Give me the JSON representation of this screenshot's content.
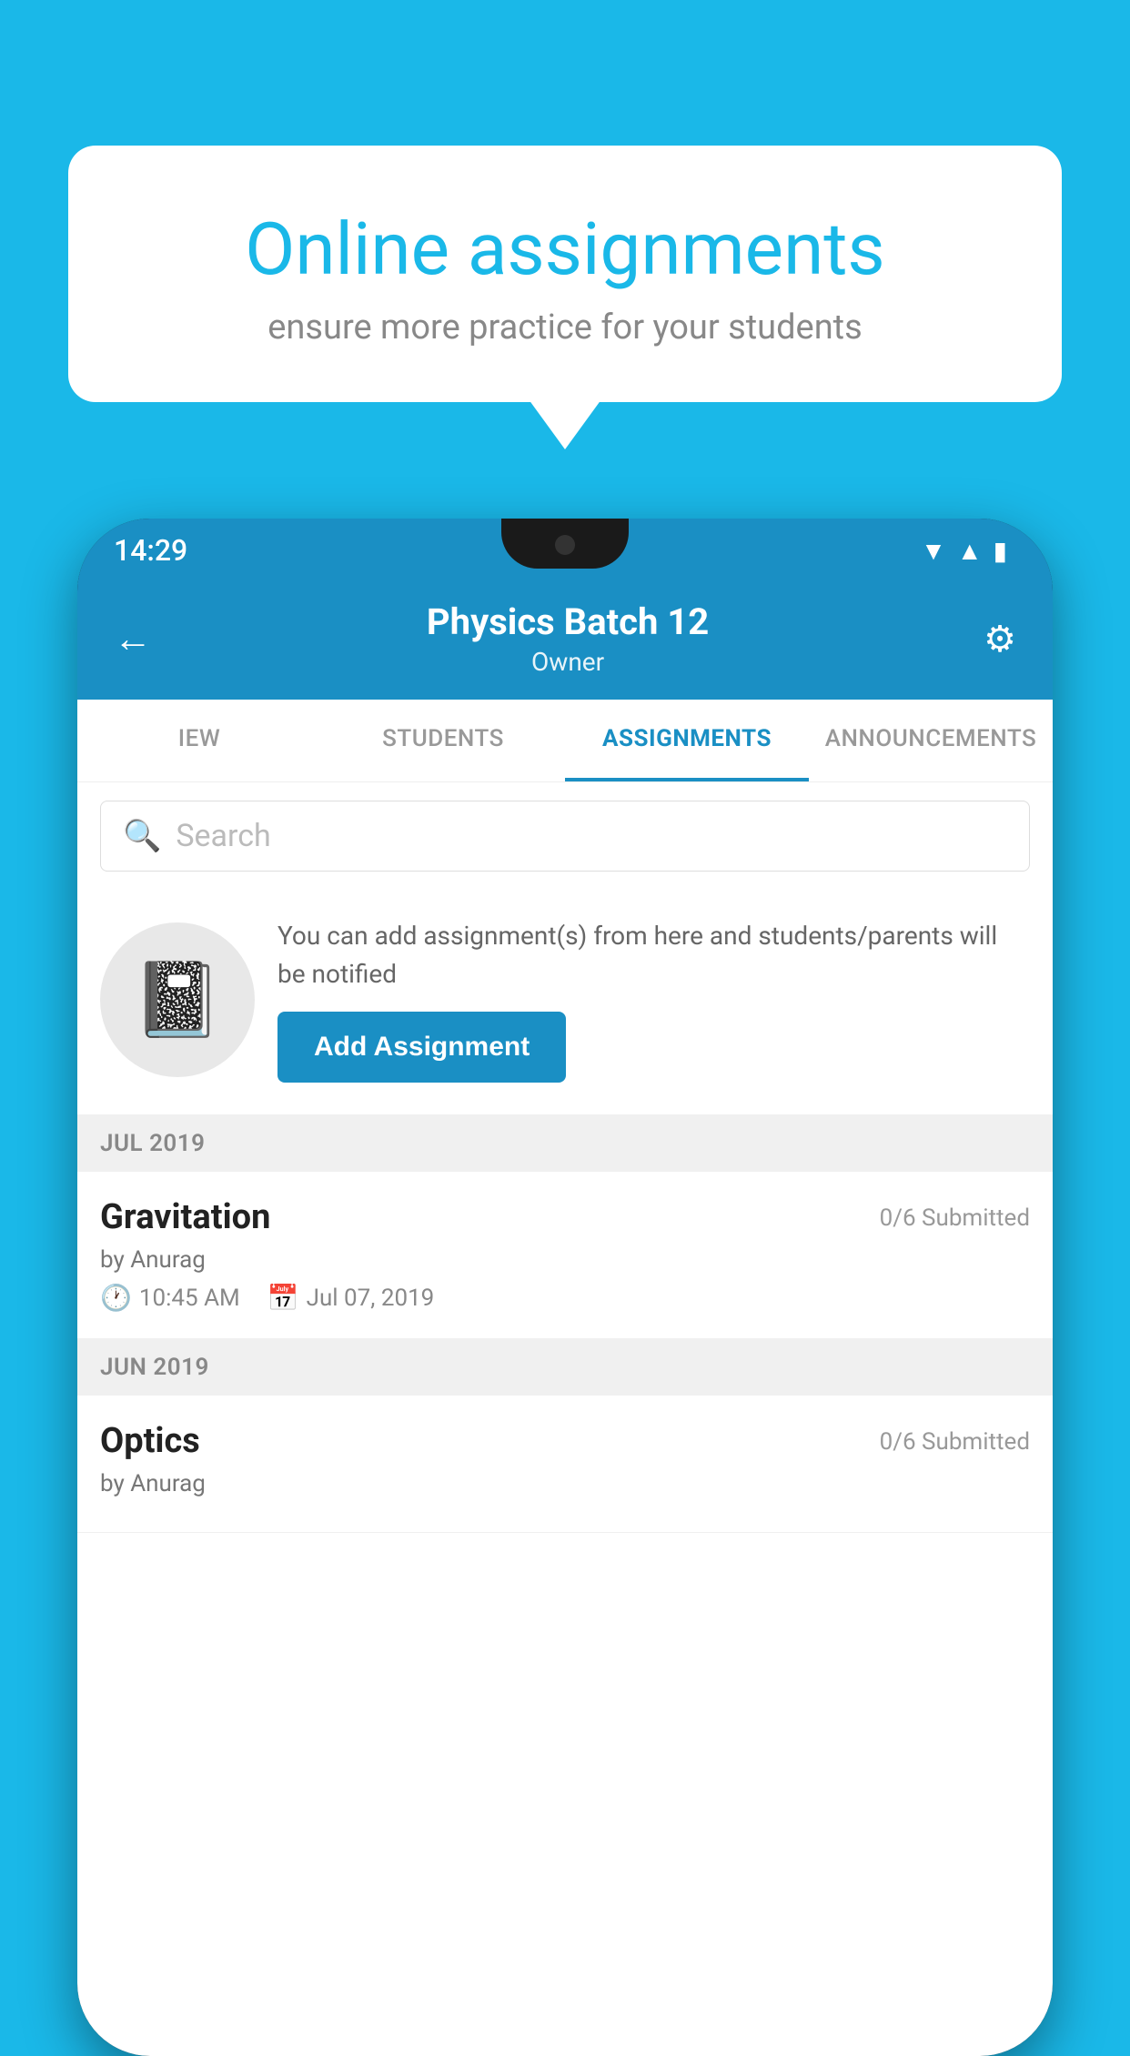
{
  "background_color": "#1ab8e8",
  "speech_bubble": {
    "title": "Online assignments",
    "subtitle": "ensure more practice for your students"
  },
  "status_bar": {
    "time": "14:29",
    "icons": [
      "wifi",
      "signal",
      "battery"
    ]
  },
  "app_header": {
    "title": "Physics Batch 12",
    "subtitle": "Owner",
    "back_label": "←",
    "settings_label": "⚙"
  },
  "tabs": [
    {
      "label": "IEW",
      "active": false
    },
    {
      "label": "STUDENTS",
      "active": false
    },
    {
      "label": "ASSIGNMENTS",
      "active": true
    },
    {
      "label": "ANNOUNCEMENTS",
      "active": false
    }
  ],
  "search": {
    "placeholder": "Search"
  },
  "promo": {
    "text": "You can add assignment(s) from here and students/parents will be notified",
    "button_label": "Add Assignment"
  },
  "sections": [
    {
      "month": "JUL 2019",
      "assignments": [
        {
          "name": "Gravitation",
          "submitted": "0/6 Submitted",
          "by": "by Anurag",
          "time": "10:45 AM",
          "date": "Jul 07, 2019"
        }
      ]
    },
    {
      "month": "JUN 2019",
      "assignments": [
        {
          "name": "Optics",
          "submitted": "0/6 Submitted",
          "by": "by Anurag",
          "time": "",
          "date": ""
        }
      ]
    }
  ]
}
